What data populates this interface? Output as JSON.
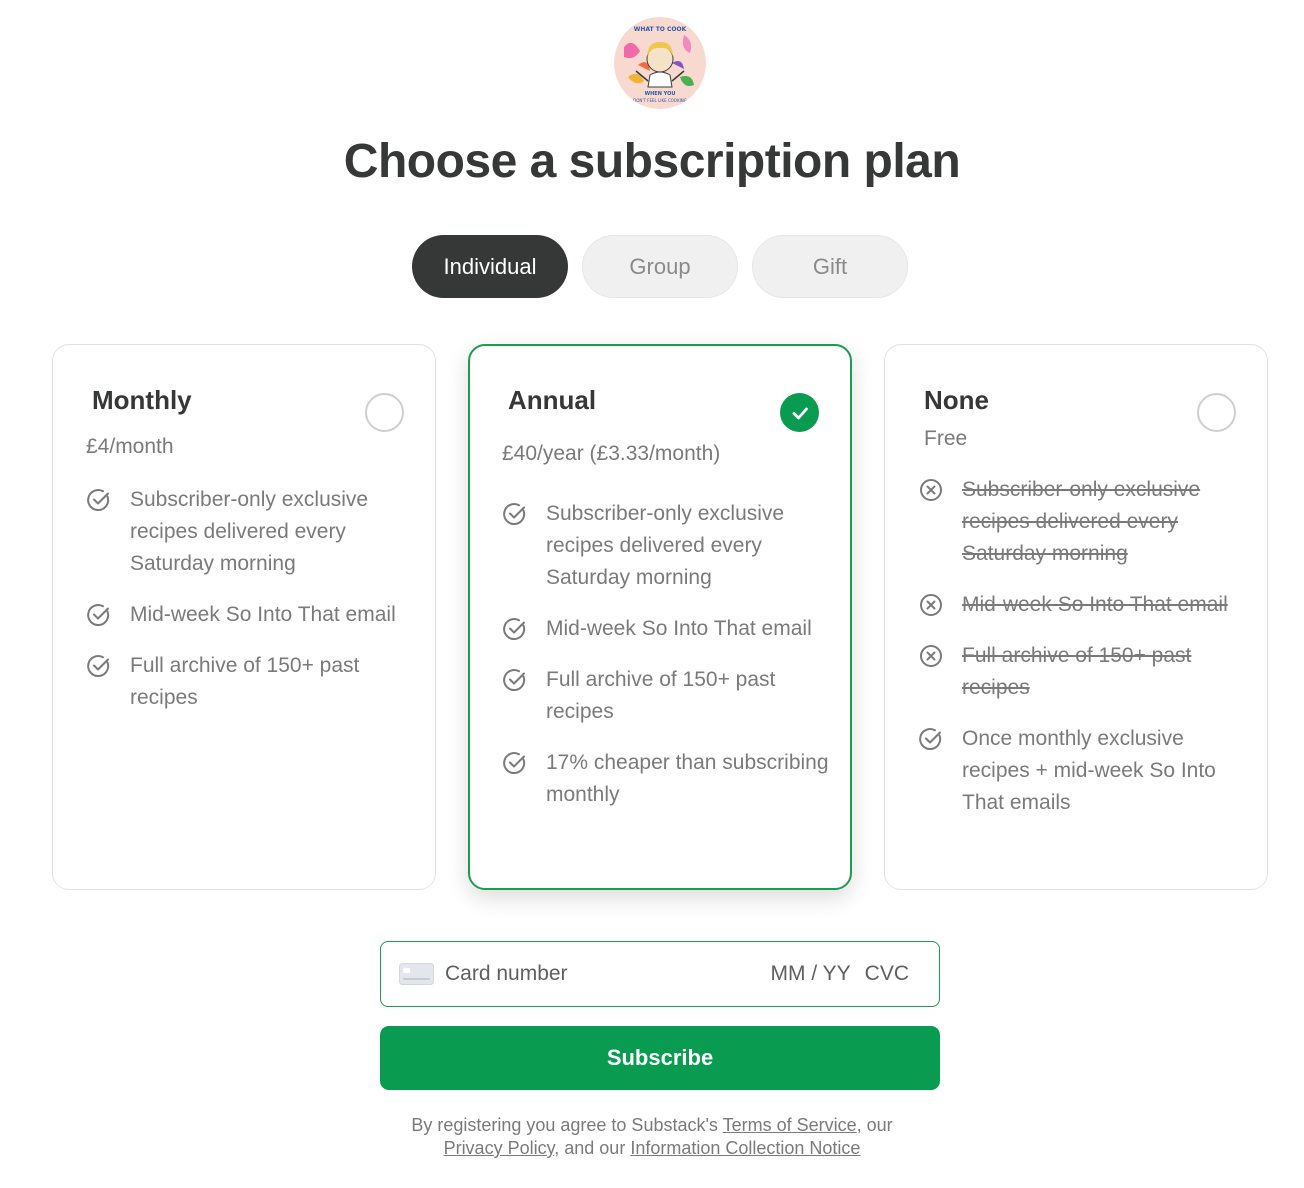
{
  "logo": {
    "name": "avatar",
    "text_top": "WHAT TO COOK",
    "text_mid": "WHEN YOU",
    "text_bottom": "DON'T FEEL LIKE COOKING"
  },
  "page_title": "Choose a subscription plan",
  "tabs": [
    {
      "label": "Individual",
      "active": true
    },
    {
      "label": "Group",
      "active": false
    },
    {
      "label": "Gift",
      "active": false
    }
  ],
  "plans": [
    {
      "title": "Monthly",
      "price": "£4/month",
      "selected": false,
      "features": [
        {
          "text": "Subscriber-only exclusive recipes delivered every Saturday morning",
          "included": true
        },
        {
          "text": "Mid-week So Into That email",
          "included": true
        },
        {
          "text": "Full archive of 150+ past recipes",
          "included": true
        }
      ]
    },
    {
      "title": "Annual",
      "price": "£40/year (£3.33/month)",
      "selected": true,
      "features": [
        {
          "text": "Subscriber-only exclusive recipes delivered every Saturday morning",
          "included": true
        },
        {
          "text": "Mid-week So Into That email",
          "included": true
        },
        {
          "text": "Full archive of 150+ past recipes",
          "included": true
        },
        {
          "text": "17% cheaper than subscribing monthly",
          "included": true
        }
      ]
    },
    {
      "title": "None",
      "price": "Free",
      "selected": false,
      "features": [
        {
          "text": "Subscriber-only exclusive recipes delivered every Saturday morning",
          "included": false
        },
        {
          "text": "Mid-week So Into That email",
          "included": false
        },
        {
          "text": "Full archive of 150+ past recipes",
          "included": false
        },
        {
          "text": "Once monthly exclusive recipes + mid-week So Into That emails",
          "included": true
        }
      ]
    }
  ],
  "card_input": {
    "number_placeholder": "Card number",
    "expiry_placeholder": "MM / YY",
    "cvc_placeholder": "CVC"
  },
  "subscribe_label": "Subscribe",
  "legal": {
    "prefix": "By registering you agree to Substack's ",
    "terms_link": "Terms of Service",
    "mid1": ", our",
    "privacy_link": "Privacy Policy",
    "mid2": ", and our ",
    "notice_link": "Information Collection Notice"
  },
  "colors": {
    "accent_green": "#099b4f",
    "selected_border": "#1f9a52",
    "dark": "#363737",
    "muted_text": "#7a7a7a"
  }
}
